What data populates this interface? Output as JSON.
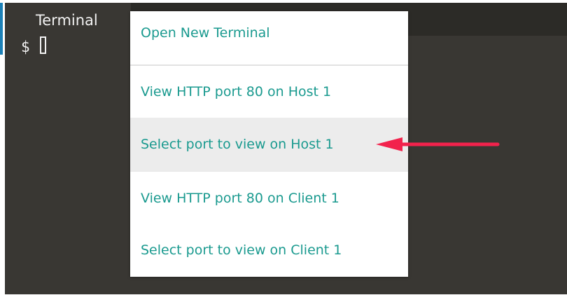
{
  "terminal": {
    "title": "Terminal",
    "prompt": "$"
  },
  "menu": {
    "items": [
      {
        "label": "Open New Terminal"
      },
      {
        "label": "View HTTP port 80 on Host 1"
      },
      {
        "label": "Select port to view on Host 1"
      },
      {
        "label": "View HTTP port 80 on Client 1"
      },
      {
        "label": "Select port to view on Client 1"
      }
    ],
    "highlighted_index": 2
  },
  "annotation": {
    "arrow_color": "#f2224c",
    "points_to": "Select port to view on Host 1"
  },
  "colors": {
    "menu_text": "#1a9a8f",
    "terminal_bg": "#393733",
    "accent": "#1b80b7"
  }
}
